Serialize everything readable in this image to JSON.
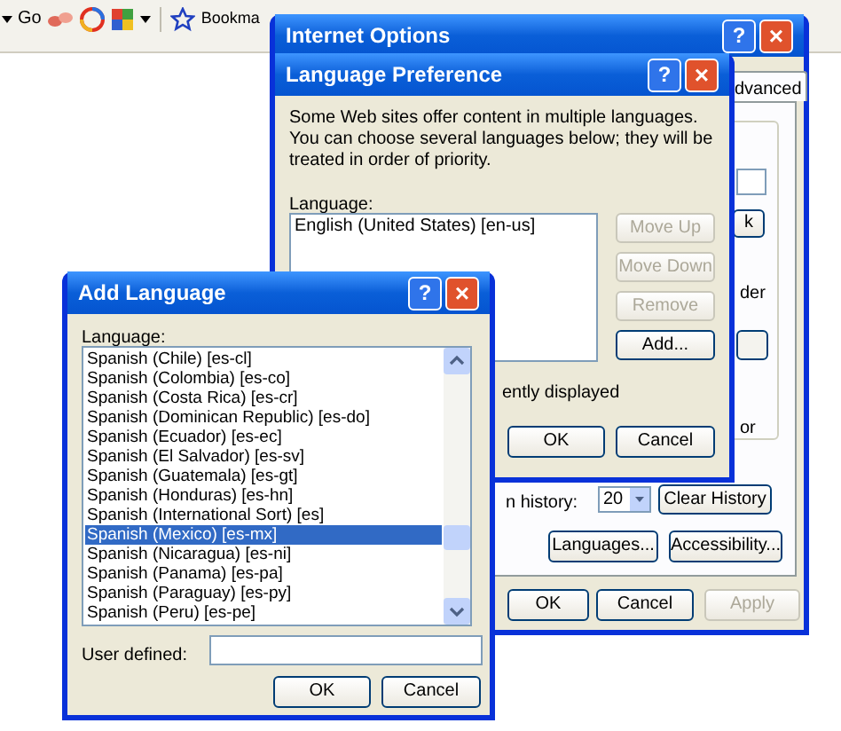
{
  "toolbar": {
    "go_label": "Go",
    "bookmarks_label": "Bookma"
  },
  "internet_options": {
    "title": "Internet Options",
    "help": "?",
    "close": "×",
    "tab": "dvanced",
    "fragment_button": "k",
    "text_1": "der",
    "text_2": "or",
    "history_label": "n history:",
    "history_days": "20",
    "clear_history": "Clear History",
    "languages_button": "Languages...",
    "accessibility_button": "Accessibility...",
    "buttons": [
      {
        "label": "OK",
        "disabled": false
      },
      {
        "label": "Cancel",
        "disabled": false
      },
      {
        "label": "Apply",
        "disabled": true
      }
    ]
  },
  "language_preference": {
    "title": "Language Preference",
    "help": "?",
    "close": "×",
    "description": "Some Web sites offer content in multiple languages. You can choose several languages below; they will be treated in order of priority.",
    "list_label": "Language:",
    "languages": [
      "English (United States) [en-us]"
    ],
    "side_buttons": [
      {
        "label": "Move Up",
        "disabled": true
      },
      {
        "label": "Move Down",
        "disabled": true
      },
      {
        "label": "Remove",
        "disabled": true
      },
      {
        "label": "Add...",
        "disabled": false
      }
    ],
    "option_text": "ently displayed",
    "ok": "OK",
    "cancel": "Cancel"
  },
  "add_language": {
    "title": "Add Language",
    "help": "?",
    "close": "×",
    "list_label": "Language:",
    "items": [
      {
        "label": "Spanish (Chile) [es-cl]",
        "selected": false
      },
      {
        "label": "Spanish (Colombia) [es-co]",
        "selected": false
      },
      {
        "label": "Spanish (Costa Rica) [es-cr]",
        "selected": false
      },
      {
        "label": "Spanish (Dominican Republic) [es-do]",
        "selected": false
      },
      {
        "label": "Spanish (Ecuador) [es-ec]",
        "selected": false
      },
      {
        "label": "Spanish (El Salvador) [es-sv]",
        "selected": false
      },
      {
        "label": "Spanish (Guatemala) [es-gt]",
        "selected": false
      },
      {
        "label": "Spanish (Honduras) [es-hn]",
        "selected": false
      },
      {
        "label": "Spanish (International Sort) [es]",
        "selected": false
      },
      {
        "label": "Spanish (Mexico) [es-mx]",
        "selected": true
      },
      {
        "label": "Spanish (Nicaragua) [es-ni]",
        "selected": false
      },
      {
        "label": "Spanish (Panama) [es-pa]",
        "selected": false
      },
      {
        "label": "Spanish (Paraguay) [es-py]",
        "selected": false
      },
      {
        "label": "Spanish (Peru) [es-pe]",
        "selected": false
      }
    ],
    "user_defined_label": "User defined:",
    "ok": "OK",
    "cancel": "Cancel"
  }
}
